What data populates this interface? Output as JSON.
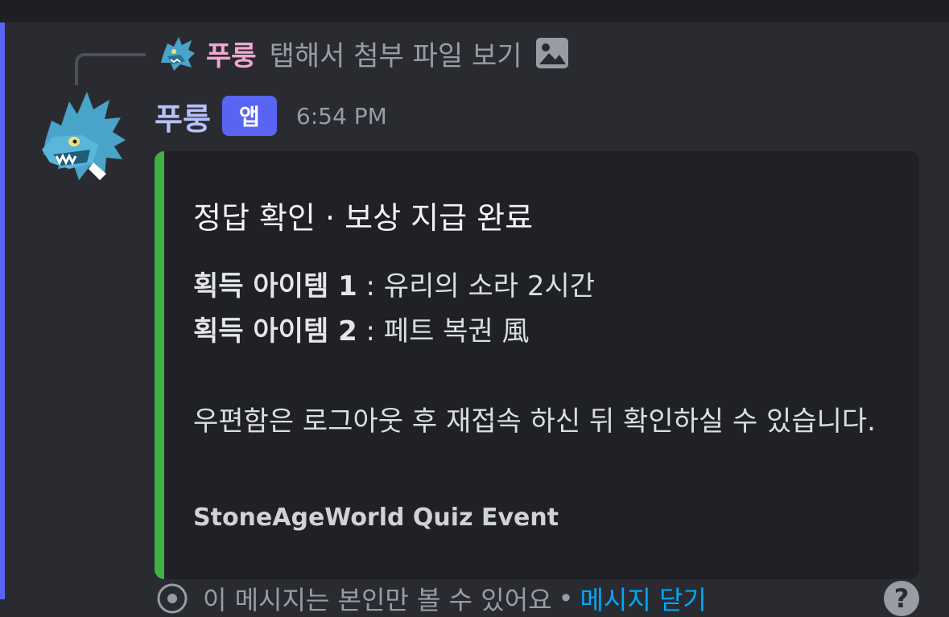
{
  "reply": {
    "author": "푸룽",
    "text": "탭해서 첨부 파일 보기",
    "icon": "image-icon"
  },
  "message": {
    "author": "푸룽",
    "badge": "앱",
    "timestamp": "6:54 PM",
    "author_color": "#b6c0fb",
    "avatar_icon": "dragon-avatar-icon"
  },
  "embed": {
    "accent_color": "#3fb144",
    "title": "정답 확인 · 보상 지급 완료",
    "fields": [
      {
        "label": "획득 아이템 1",
        "value": " : 유리의 소라 2시간"
      },
      {
        "label": "획득 아이템 2",
        "value": " : 페트 복권 風"
      }
    ],
    "note": "우편함은 로그아웃 후 재접속 하신 뒤 확인하실 수 있습니다.",
    "footer": "StoneAgeWorld Quiz Event"
  },
  "ephemeral": {
    "text": "이 메시지는 본인만 볼 수 있어요",
    "separator": "•",
    "dismiss_label": "메시지 닫기",
    "help": "?"
  }
}
